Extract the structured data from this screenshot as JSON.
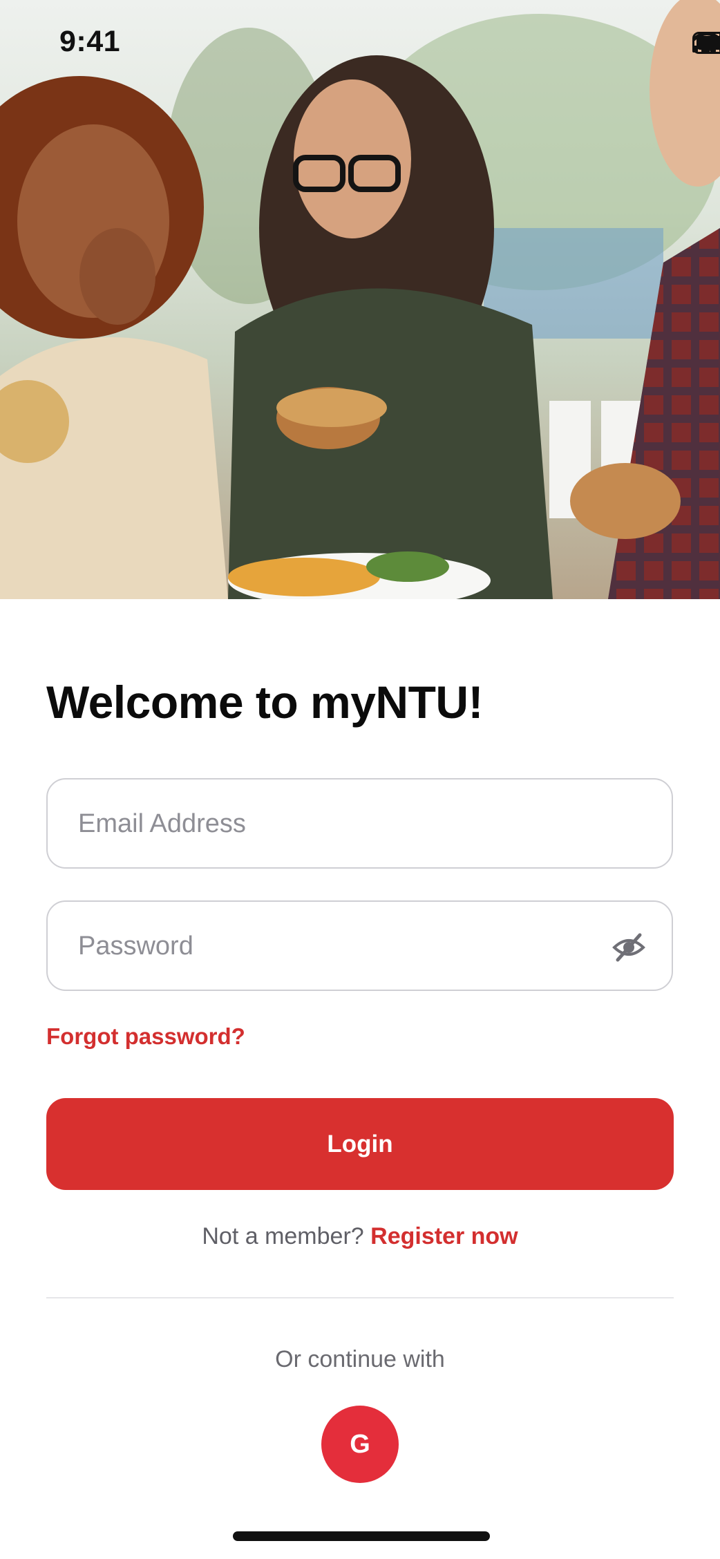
{
  "status_bar": {
    "time": "9:41",
    "icons": [
      "signal-icon",
      "wifi-icon",
      "battery-icon"
    ]
  },
  "hero": {
    "image": "friends-eating-burgers-photo"
  },
  "login": {
    "title": "Welcome to myNTU!",
    "email": {
      "placeholder": "Email Address",
      "value": ""
    },
    "password": {
      "placeholder": "Password",
      "value": "",
      "toggle_icon": "eye-slash-icon"
    },
    "forgot_label": "Forgot password?",
    "login_label": "Login",
    "register_prompt": "Not a member?",
    "register_link": "Register now",
    "continue_label": "Or continue with",
    "google_label": "G"
  },
  "colors": {
    "accent": "#d8302f",
    "link": "#d32f2f",
    "google": "#e42e3b",
    "border": "#cfcfd4"
  }
}
